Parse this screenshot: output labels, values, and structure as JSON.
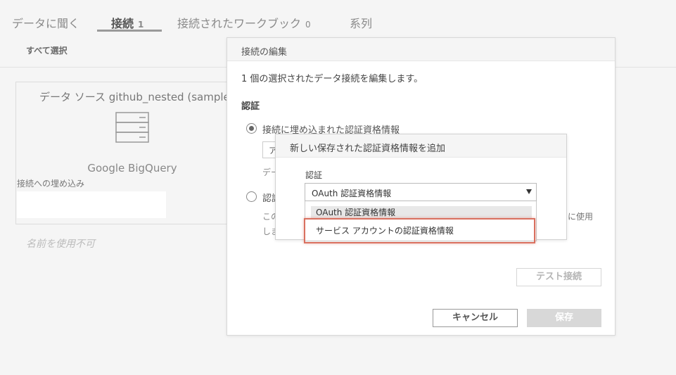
{
  "tabs": {
    "ask_data": "データに聞く",
    "connections": "接続",
    "connections_count": "1",
    "workbooks": "接続されたワークブック",
    "workbooks_count": "0",
    "lineage": "系列"
  },
  "toolbar": {
    "select_all": "すべて選択"
  },
  "datasource": {
    "title": "データ ソース github_nested (samples",
    "type": "Google BigQuery",
    "embed_label": "接続への埋め込み",
    "name_unavailable": "名前を使用不可"
  },
  "edit_dialog": {
    "title": "接続の編集",
    "description": "1 個の選択されたデータ接続を編集します。",
    "auth_heading": "認証",
    "option_embedded": "接続に埋め込まれた認証資格情報",
    "option_prompt_partial": "認証",
    "partial_box": "ア",
    "partial_desc_1": "デー",
    "partial_desc_2": "この",
    "partial_desc_3": "しま",
    "partial_right": "に使用",
    "test_button": "テスト接続",
    "cancel_button": "キャンセル",
    "save_button": "保存"
  },
  "add_credential_dialog": {
    "title": "新しい保存された認証資格情報を追加",
    "auth_label": "認証",
    "selected_value": "OAuth 認証資格情報",
    "options": [
      "OAuth 認証資格情報",
      "サービス アカウントの認証資格情報"
    ]
  },
  "colors": {
    "highlight_border": "#d9705f",
    "save_disabled": "#d8d8d8"
  }
}
